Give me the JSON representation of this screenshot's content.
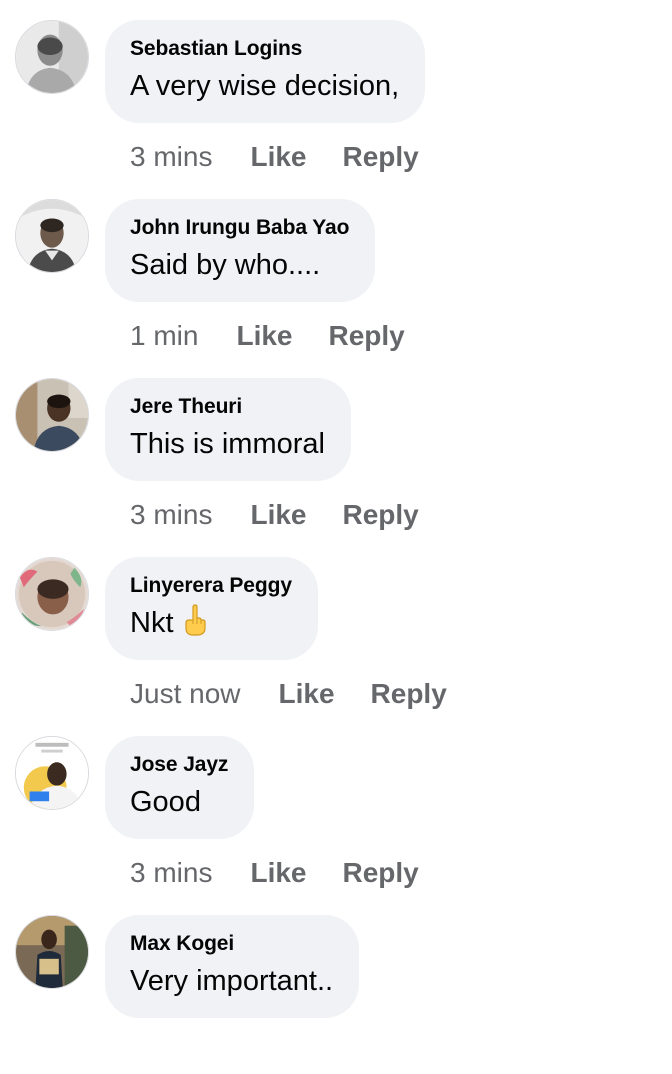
{
  "comments": [
    {
      "author": "Sebastian Logins",
      "text": "A very wise decision,",
      "time": "3 mins",
      "like_label": "Like",
      "reply_label": "Reply",
      "avatar_icon": "profile-photo-icon"
    },
    {
      "author": "John Irungu Baba Yao",
      "text": "Said by who....",
      "time": "1 min",
      "like_label": "Like",
      "reply_label": "Reply",
      "avatar_icon": "profile-photo-icon"
    },
    {
      "author": "Jere Theuri",
      "text": "This is immoral",
      "time": "3 mins",
      "like_label": "Like",
      "reply_label": "Reply",
      "avatar_icon": "profile-photo-icon"
    },
    {
      "author": "Linyerera Peggy",
      "text": "Nkt",
      "emoji_icon": "middle-finger-emoji-icon",
      "time": "Just now",
      "like_label": "Like",
      "reply_label": "Reply",
      "avatar_icon": "profile-photo-icon"
    },
    {
      "author": "Jose Jayz",
      "text": "Good",
      "time": "3 mins",
      "like_label": "Like",
      "reply_label": "Reply",
      "avatar_icon": "profile-photo-icon"
    },
    {
      "author": "Max Kogei",
      "text": "Very important..",
      "avatar_icon": "profile-photo-icon"
    }
  ],
  "colors": {
    "bubble_background": "#f0f2f5",
    "author_text": "#050505",
    "meta_text": "#65676b"
  }
}
